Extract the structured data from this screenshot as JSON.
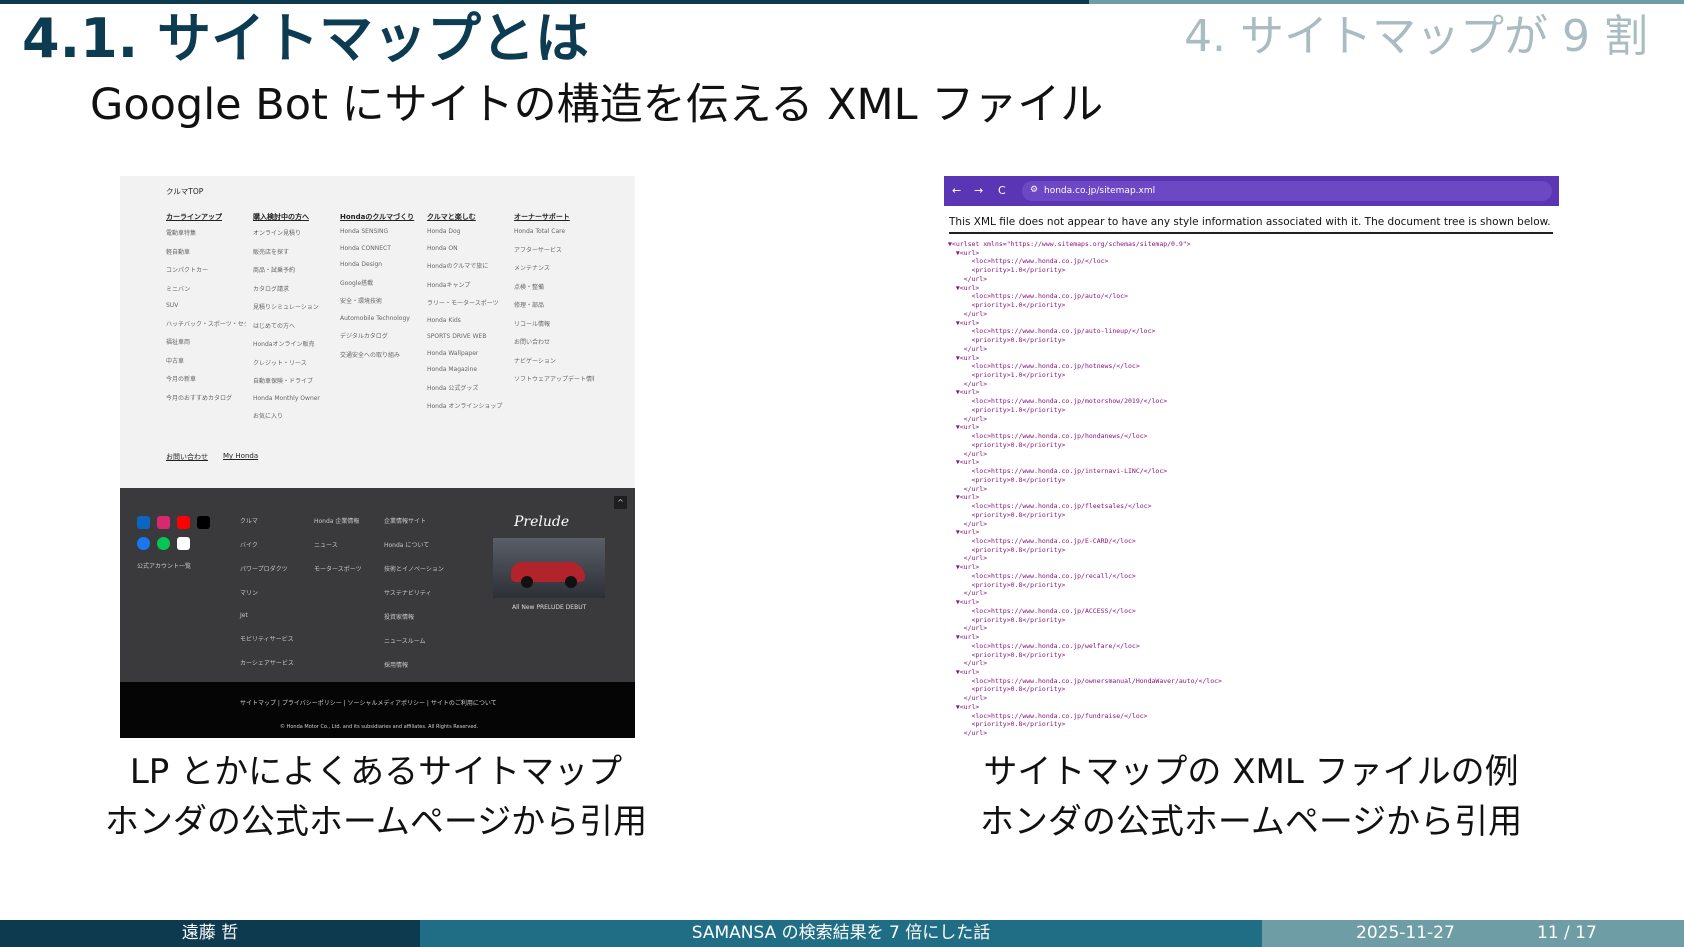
{
  "slide": {
    "title": "4.1. サイトマップとは",
    "section": "4. サイトマップが 9 割",
    "subtitle": "Google Bot にサイトの構造を伝える XML ファイル"
  },
  "left_figure": {
    "caption_line1": "LP とかによくあるサイトマップ",
    "caption_line2": "ホンダの公式ホームページから引用",
    "top_link": "クルマTOP",
    "columns": [
      {
        "heading": "カーラインアップ",
        "items": [
          "電動車特集",
          "軽自動車",
          "コンパクトカー",
          "ミニバン",
          "SUV",
          "ハッチバック・スポーツ・セダン",
          "福祉車両",
          "中古車",
          "今月の新車",
          "今月のおすすめカタログ"
        ]
      },
      {
        "heading": "購入検討中の方へ",
        "items": [
          "オンライン見積り",
          "販売店を探す",
          "商品・試乗予約",
          "カタログ請求",
          "見積りシミュレーション",
          "はじめての方へ",
          "Hondaオンライン販売",
          "クレジット・リース",
          "自動車保険・ドライブ",
          "Honda Monthly Owner",
          "お気に入り"
        ]
      },
      {
        "heading": "Hondaのクルマづくり",
        "items": [
          "Honda SENSING",
          "Honda CONNECT",
          "Honda Design",
          "Google搭載",
          "安全・環境技術",
          "Automobile Technology",
          "デジタルカタログ",
          "交通安全への取り組み"
        ]
      },
      {
        "heading": "クルマと楽しむ",
        "items": [
          "Honda Dog",
          "Honda ON",
          "Hondaのクルマで旅に",
          "Hondaキャンプ",
          "ラリー・モータースポーツ",
          "Honda Kids",
          "SPORTS DRIVE WEB",
          "Honda Wallpaper",
          "Honda Magazine",
          "Honda 公式グッズ",
          "Honda オンラインショップ"
        ]
      },
      {
        "heading": "オーナーサポート",
        "items": [
          "Honda Total Care",
          "アフターサービス",
          "メンテナンス",
          "点検・整備",
          "修理・部品",
          "リコール情報",
          "お問い合わせ",
          "ナビゲーション",
          "ソフトウェアアップデート情報"
        ]
      }
    ],
    "contact_links": [
      "お問い合わせ",
      "My Honda"
    ],
    "footer_columns": [
      [
        "クルマ",
        "バイク",
        "パワープロダクツ",
        "マリン",
        "Jet",
        "モビリティサービス",
        "カーシェアサービス"
      ],
      [
        "Honda 企業情報",
        "ニュース",
        "モータースポーツ"
      ],
      [
        "企業情報サイト",
        "Honda について",
        "技術とイノベーション",
        "サステナビリティ",
        "投資家情報",
        "ニュースルーム",
        "採用情報"
      ]
    ],
    "social_accounts_label": "公式アカウント一覧",
    "scroll_top": "^",
    "promo_logo": "Prelude",
    "promo_text": "All New PRELUDE DEBUT",
    "bottom_links": "サイトマップ | プライバシーポリシー | ソーシャルメディアポリシー | サイトのご利用について",
    "copyright": "© Honda Motor Co., Ltd. and its subsidiaries and affiliates. All Rights Reserved."
  },
  "right_figure": {
    "caption_line1": "サイトマップの XML ファイルの例",
    "caption_line2": "ホンダの公式ホームページから引用",
    "browser": {
      "back": "←",
      "forward": "→",
      "reload": "C",
      "url": "honda.co.jp/sitemap.xml"
    },
    "notice": "This XML file does not appear to have any style information associated with it. The document tree is shown below.",
    "urlset_open": "▼<urlset xmlns=\"https://www.sitemaps.org/schemas/sitemap/0.9\">",
    "entries": [
      {
        "loc": "https://www.honda.co.jp/",
        "priority": "1.0"
      },
      {
        "loc": "https://www.honda.co.jp/auto/",
        "priority": "1.0"
      },
      {
        "loc": "https://www.honda.co.jp/auto-lineup/",
        "priority": "0.8"
      },
      {
        "loc": "https://www.honda.co.jp/hotnews/",
        "priority": "1.0"
      },
      {
        "loc": "https://www.honda.co.jp/motorshow/2019/",
        "priority": "1.0"
      },
      {
        "loc": "https://www.honda.co.jp/hondanews/",
        "priority": "0.8"
      },
      {
        "loc": "https://www.honda.co.jp/internavi-LINC/",
        "priority": "0.8"
      },
      {
        "loc": "https://www.honda.co.jp/fleetsales/",
        "priority": "0.8"
      },
      {
        "loc": "https://www.honda.co.jp/E-CARD/",
        "priority": "0.8"
      },
      {
        "loc": "https://www.honda.co.jp/recall/",
        "priority": "0.8"
      },
      {
        "loc": "https://www.honda.co.jp/ACCESS/",
        "priority": "0.8"
      },
      {
        "loc": "https://www.honda.co.jp/welfare/",
        "priority": "0.8"
      },
      {
        "loc": "https://www.honda.co.jp/ownersmanual/HondaWaver/auto/",
        "priority": "0.8"
      },
      {
        "loc": "https://www.honda.co.jp/fundraise/",
        "priority": "0.8"
      }
    ]
  },
  "footer": {
    "author": "遠藤 哲",
    "talk_title": "SAMANSA の検索結果を 7 倍にした話",
    "date": "2025-11-27",
    "page": "11 / 17"
  },
  "colors": {
    "navy": "#0e3a4f",
    "teal": "#1f6e85",
    "slate": "#6f9da6",
    "browser_purple": "#5a36b4",
    "xml_tag": "#881280"
  }
}
